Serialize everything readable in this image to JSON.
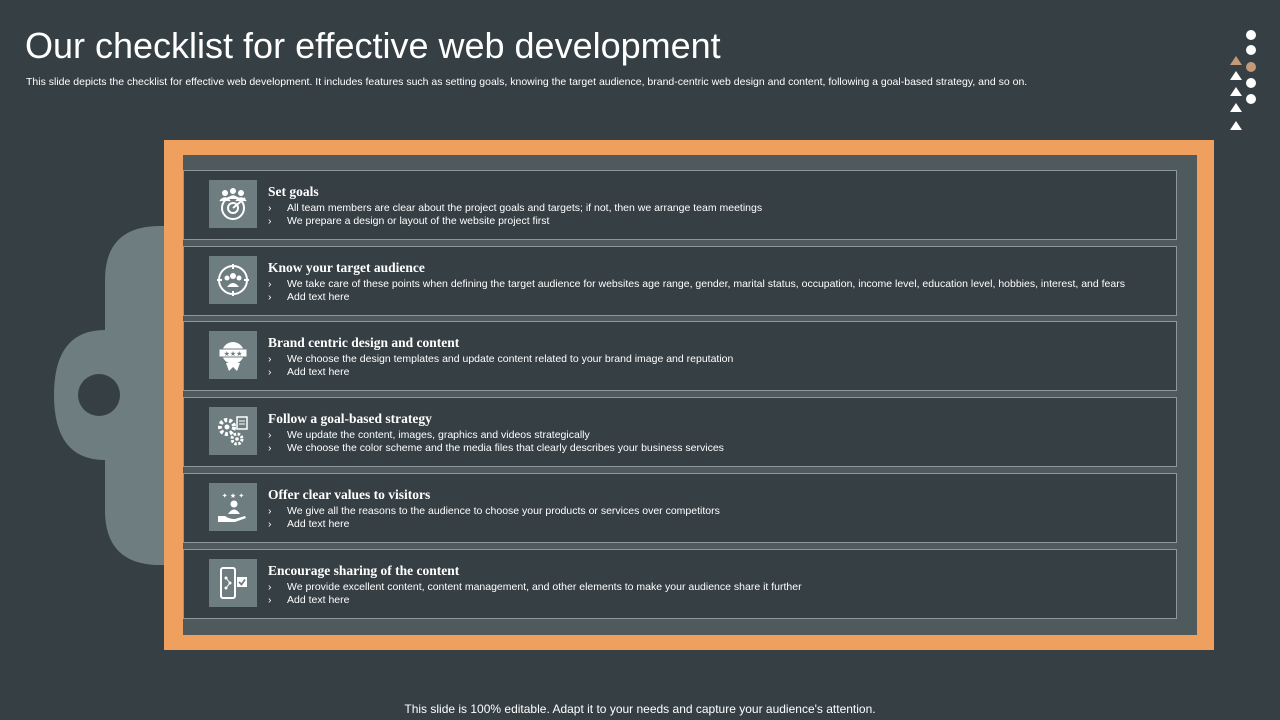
{
  "title": "Our checklist for effective web development",
  "subtitle": "This slide depicts the checklist for effective web development. It includes features such as setting goals, knowing the target audience, brand-centric web design and content, following a goal-based strategy, and so on.",
  "bullet_glyph": "›",
  "items": [
    {
      "title": "Set goals",
      "icon": "team-target-icon",
      "bullets": [
        "All team members are clear about the project goals and targets; if not, then we arrange team meetings",
        "We prepare a design or layout of the website project first"
      ]
    },
    {
      "title": "Know your target audience",
      "icon": "audience-target-icon",
      "bullets": [
        "We take care of these points when defining the target audience for websites age range, gender, marital status, occupation, income level, education level, hobbies, interest, and fears",
        "Add text here"
      ]
    },
    {
      "title": "Brand centric design and content",
      "icon": "brand-badge-icon",
      "bullets": [
        "We choose the design templates and update content related to your brand image and reputation",
        "Add text here"
      ]
    },
    {
      "title": "Follow a goal-based strategy",
      "icon": "gears-strategy-icon",
      "bullets": [
        "We update the content, images, graphics and videos strategically",
        "We choose the color scheme and the media files that clearly describes your business services"
      ]
    },
    {
      "title": "Offer clear values to visitors",
      "icon": "hand-value-icon",
      "bullets": [
        "We give all the reasons to the audience to choose your products or services over competitors",
        "Add text here"
      ]
    },
    {
      "title": "Encourage sharing of the content",
      "icon": "mobile-share-icon",
      "bullets": [
        "We provide excellent content, content management, and other elements to make your audience share it further",
        "Add text here"
      ]
    }
  ],
  "footer": "This slide is 100% editable. Adapt it to your needs and capture your audience's attention.",
  "colors": {
    "background": "#363f43",
    "accent": "#f0a05e",
    "panel": "#4f5a5d",
    "icon_box": "#6e7d80",
    "blob": "#6e7d80"
  }
}
